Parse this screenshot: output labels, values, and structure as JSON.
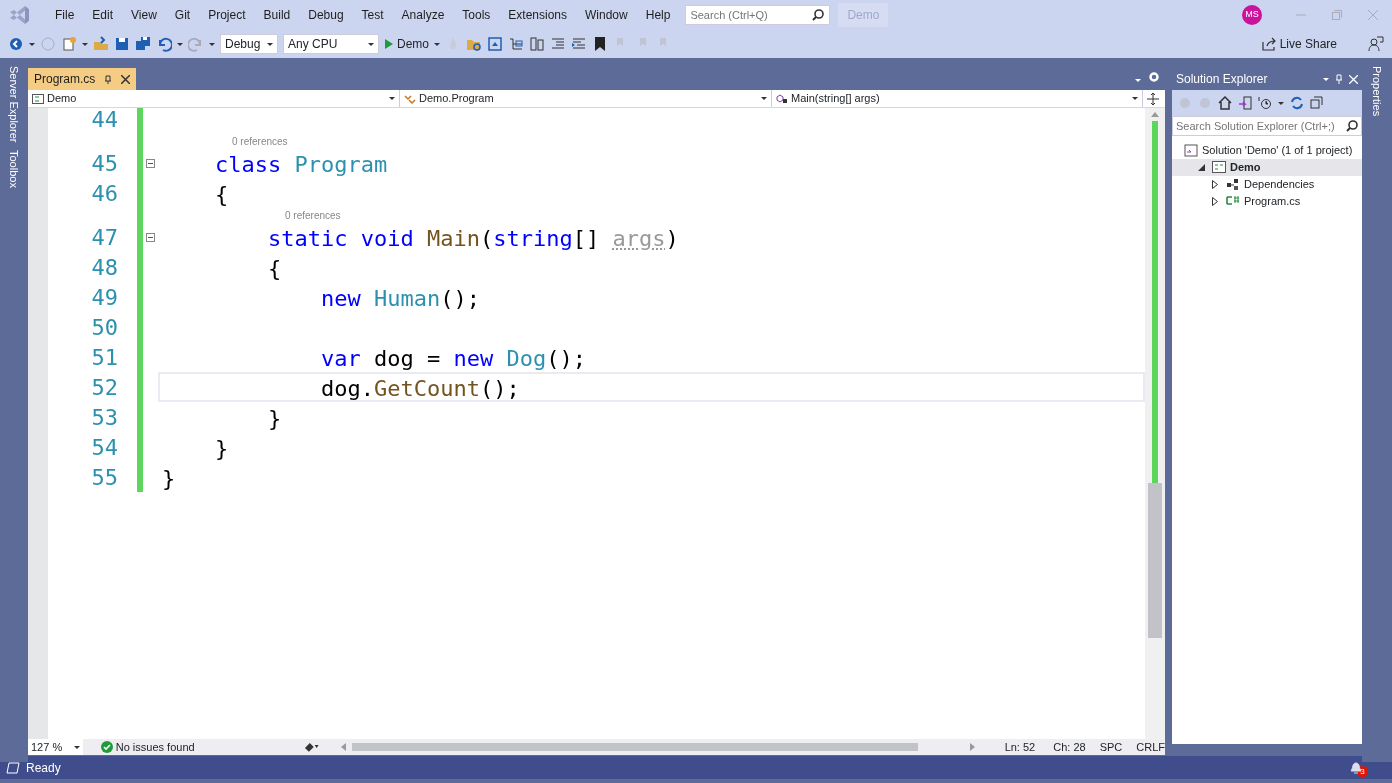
{
  "window": {
    "menu": [
      "File",
      "Edit",
      "View",
      "Git",
      "Project",
      "Build",
      "Debug",
      "Test",
      "Analyze",
      "Tools",
      "Extensions",
      "Window",
      "Help"
    ],
    "search": {
      "placeholder": "Search (Ctrl+Q)"
    },
    "solution_name": "Demo",
    "account_initials": "MS"
  },
  "toolbar": {
    "configuration": "Debug",
    "platform": "Any CPU",
    "start_target": "Demo",
    "live_share": "Live Share"
  },
  "side_tabs_left": [
    "Server Explorer",
    "Toolbox"
  ],
  "side_tabs_right": [
    "Properties"
  ],
  "tabs": [
    {
      "label": "Program.cs",
      "selected": true
    }
  ],
  "navigation": {
    "project": "Demo",
    "type": "Demo.Program",
    "member": "Main(string[] args)"
  },
  "code_lines": [
    {
      "number": "44",
      "current": false,
      "foldable": false
    },
    {
      "number": "45",
      "current": false,
      "foldable": true,
      "codelens": "0 references",
      "tokens": [
        {
          "kind": "keyword",
          "text": "    class"
        },
        {
          "kind": "type",
          "text": " Program"
        }
      ]
    },
    {
      "number": "46",
      "current": false,
      "foldable": false,
      "tokens": [
        {
          "kind": "plain",
          "text": "    {"
        }
      ]
    },
    {
      "number": "47",
      "current": false,
      "foldable": true,
      "codelens": "0 references",
      "tokens": [
        {
          "kind": "keyword",
          "text": "        static"
        },
        {
          "kind": "keyword",
          "text": " void"
        },
        {
          "kind": "method",
          "text": " Main"
        },
        {
          "kind": "plain",
          "text": "("
        },
        {
          "kind": "keyword",
          "text": "string"
        },
        {
          "kind": "plain",
          "text": "[] "
        },
        {
          "kind": "unused",
          "text": "args"
        },
        {
          "kind": "plain",
          "text": ")"
        }
      ]
    },
    {
      "number": "48",
      "current": false,
      "foldable": false,
      "tokens": [
        {
          "kind": "plain",
          "text": "        {"
        }
      ]
    },
    {
      "number": "49",
      "current": false,
      "foldable": false,
      "tokens": [
        {
          "kind": "keyword",
          "text": "            new"
        },
        {
          "kind": "type",
          "text": " Human"
        },
        {
          "kind": "plain",
          "text": "();"
        }
      ]
    },
    {
      "number": "50",
      "current": false,
      "foldable": false
    },
    {
      "number": "51",
      "current": false,
      "foldable": false,
      "tokens": [
        {
          "kind": "keyword",
          "text": "            var"
        },
        {
          "kind": "plain",
          "text": " dog = "
        },
        {
          "kind": "keyword",
          "text": "new"
        },
        {
          "kind": "type",
          "text": " Dog"
        },
        {
          "kind": "plain",
          "text": "();"
        }
      ]
    },
    {
      "number": "52",
      "current": true,
      "foldable": false,
      "tokens": [
        {
          "kind": "plain",
          "text": "            dog."
        },
        {
          "kind": "method",
          "text": "GetCount"
        },
        {
          "kind": "plain",
          "text": "();"
        }
      ]
    },
    {
      "number": "53",
      "current": false,
      "foldable": false,
      "tokens": [
        {
          "kind": "plain",
          "text": "        }"
        }
      ]
    },
    {
      "number": "54",
      "current": false,
      "foldable": false,
      "tokens": [
        {
          "kind": "plain",
          "text": "    }"
        }
      ]
    },
    {
      "number": "55",
      "current": false,
      "foldable": false,
      "tokens": [
        {
          "kind": "plain",
          "text": "}"
        }
      ]
    }
  ],
  "editor_status": {
    "zoom": "127 %",
    "issues": "No issues found",
    "line": "Ln: 52",
    "column": "Ch: 28",
    "whitespace": "SPC",
    "line_ending": "CRLF"
  },
  "solution_explorer": {
    "title": "Solution Explorer",
    "search": {
      "placeholder": "Search Solution Explorer (Ctrl+;)"
    },
    "tree": [
      {
        "kind": "solution",
        "label": "Solution 'Demo' (1 of 1 project)",
        "selected": false,
        "children": [
          {
            "kind": "project",
            "label": "Demo",
            "selected": true,
            "expanded": true,
            "children": [
              {
                "kind": "dependencies",
                "label": "Dependencies",
                "selected": false,
                "expanded": false
              },
              {
                "kind": "file",
                "label": "Program.cs",
                "selected": false,
                "expanded": false
              }
            ]
          }
        ]
      }
    ]
  },
  "status_bar": {
    "text": "Ready",
    "notifications": "3"
  }
}
